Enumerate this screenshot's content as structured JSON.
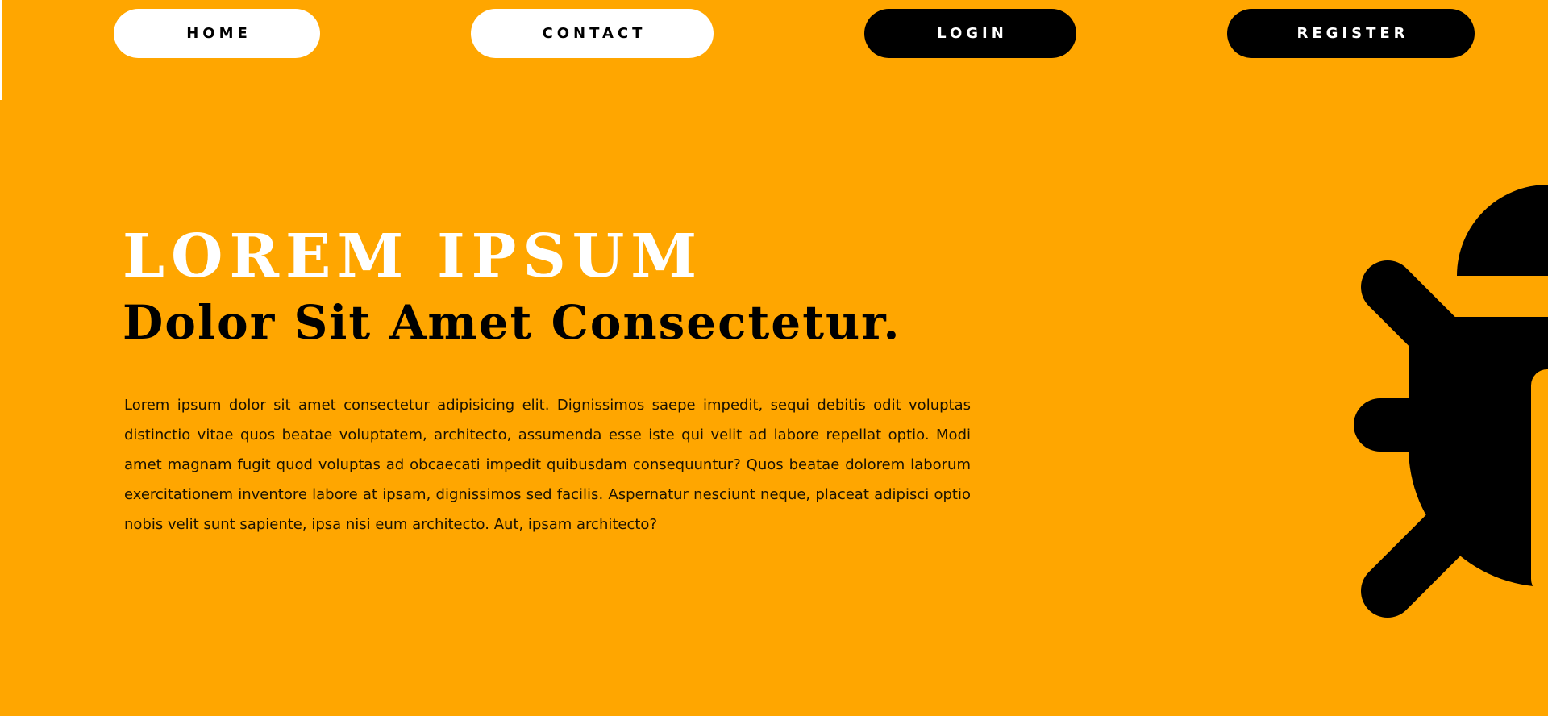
{
  "nav": {
    "home_label": "HOME",
    "contact_label": "CONTACT",
    "login_label": "LOGIN",
    "register_label": "REGISTER"
  },
  "hero": {
    "title": "LOREM IPSUM",
    "subtitle": "Dolor Sit Amet Consectetur.",
    "body": "Lorem ipsum dolor sit amet consectetur adipisicing elit. Dignissimos saepe impedit, sequi debitis odit voluptas distinctio vitae quos beatae voluptatem, architecto, assumenda esse iste qui velit ad labore repellat optio. Modi amet magnam fugit quod voluptas ad obcaecati impedit quibusdam consequuntur? Quos beatae dolorem laborum exercitationem inventore labore at ipsam, dignissimos sed facilis. Aspernatur nesciunt neque, placeat adipisci optio nobis velit sunt sapiente, ipsa nisi eum architecto. Aut, ipsam architecto?"
  },
  "decor": {
    "icon": "bug-icon"
  },
  "colors": {
    "background": "#FFA600",
    "light_button": "#FFFFFF",
    "dark_button": "#000000",
    "title": "#FFFFFF",
    "subtitle": "#000000"
  }
}
